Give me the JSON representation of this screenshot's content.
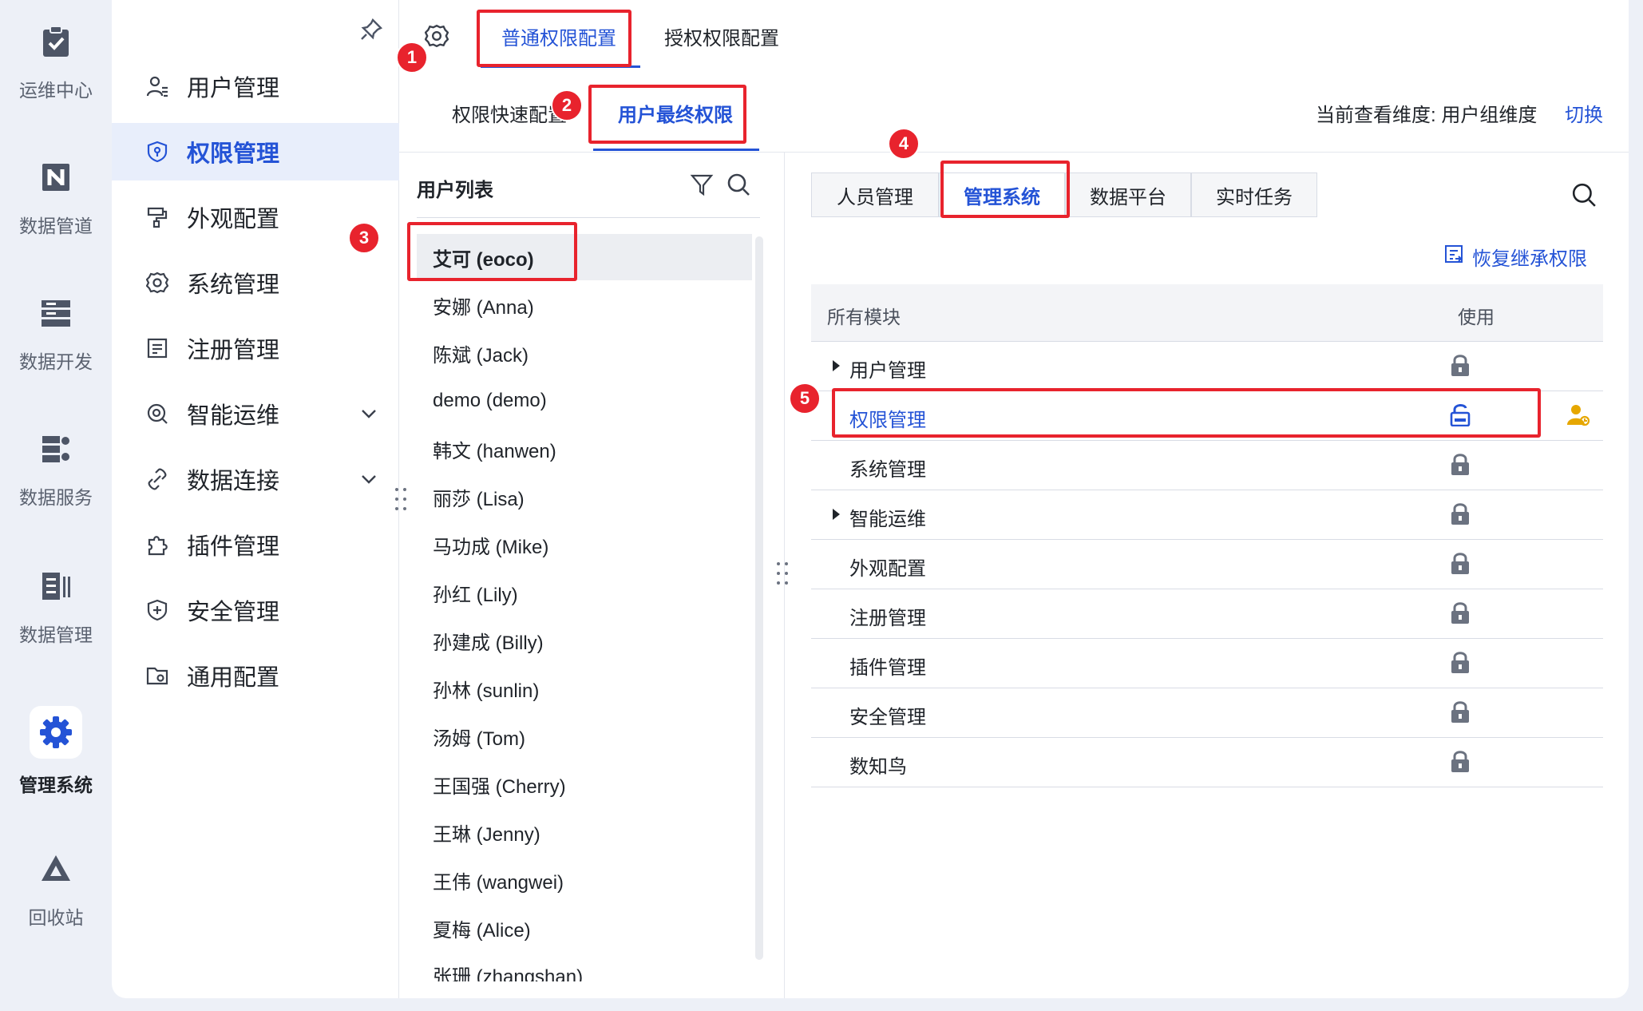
{
  "rail": {
    "items": [
      {
        "label": "运维中心",
        "icon": "clipboard-check-icon"
      },
      {
        "label": "数据管道",
        "icon": "pipeline-icon"
      },
      {
        "label": "数据开发",
        "icon": "server-stack-icon"
      },
      {
        "label": "数据服务",
        "icon": "data-service-icon"
      },
      {
        "label": "数据管理",
        "icon": "data-manage-icon"
      },
      {
        "label": "管理系统",
        "icon": "gear-icon",
        "active": true
      },
      {
        "label": "回收站",
        "icon": "recycle-icon"
      }
    ]
  },
  "nav": {
    "items": [
      {
        "label": "用户管理",
        "icon": "user-list-icon"
      },
      {
        "label": "权限管理",
        "icon": "shield-icon",
        "active": true
      },
      {
        "label": "外观配置",
        "icon": "paint-roller-icon"
      },
      {
        "label": "系统管理",
        "icon": "gear-icon"
      },
      {
        "label": "注册管理",
        "icon": "register-icon"
      },
      {
        "label": "智能运维",
        "icon": "smart-ops-icon",
        "expandable": true
      },
      {
        "label": "数据连接",
        "icon": "link-icon",
        "expandable": true
      },
      {
        "label": "插件管理",
        "icon": "puzzle-icon"
      },
      {
        "label": "安全管理",
        "icon": "shield-plus-icon"
      },
      {
        "label": "通用配置",
        "icon": "folder-gear-icon"
      }
    ]
  },
  "top_tabs": {
    "normal": "普通权限配置",
    "auth": "授权权限配置"
  },
  "sub_tabs": {
    "quick": "权限快速配置",
    "final": "用户最终权限"
  },
  "dimension": {
    "label": "当前查看维度: 用户组维度",
    "switch": "切换"
  },
  "user_list": {
    "title": "用户列表",
    "users": [
      "艾可 (eoco)",
      "安娜 (Anna)",
      "陈斌 (Jack)",
      "demo (demo)",
      "韩文 (hanwen)",
      "丽莎 (Lisa)",
      "马功成 (Mike)",
      "孙红 (Lily)",
      "孙建成 (Billy)",
      "孙林 (sunlin)",
      "汤姆 (Tom)",
      "王国强 (Cherry)",
      "王琳 (Jenny)",
      "王伟 (wangwei)",
      "夏梅 (Alice)",
      "张珊 (zhangshan)"
    ],
    "selected": 0
  },
  "module_tabs": [
    "人员管理",
    "管理系统",
    "数据平台",
    "实时任务"
  ],
  "module_tab_active": 1,
  "restore": "恢复继承权限",
  "table": {
    "headers": {
      "module": "所有模块",
      "use": "使用"
    },
    "rows": [
      {
        "name": "用户管理",
        "expandable": true,
        "lock": "locked"
      },
      {
        "name": "权限管理",
        "expandable": false,
        "lock": "unlocked",
        "highlight": true
      },
      {
        "name": "系统管理",
        "expandable": false,
        "lock": "locked"
      },
      {
        "name": "智能运维",
        "expandable": true,
        "lock": "locked"
      },
      {
        "name": "外观配置",
        "expandable": false,
        "lock": "locked"
      },
      {
        "name": "注册管理",
        "expandable": false,
        "lock": "locked"
      },
      {
        "name": "插件管理",
        "expandable": false,
        "lock": "locked"
      },
      {
        "name": "安全管理",
        "expandable": false,
        "lock": "locked"
      },
      {
        "name": "数知鸟",
        "expandable": false,
        "lock": "locked"
      }
    ]
  },
  "badges": [
    "1",
    "2",
    "3",
    "4",
    "5"
  ],
  "colors": {
    "accent": "#2453d6",
    "annotation": "#e8232d",
    "lock": "#6b7280",
    "inherit": "#e6a700"
  }
}
